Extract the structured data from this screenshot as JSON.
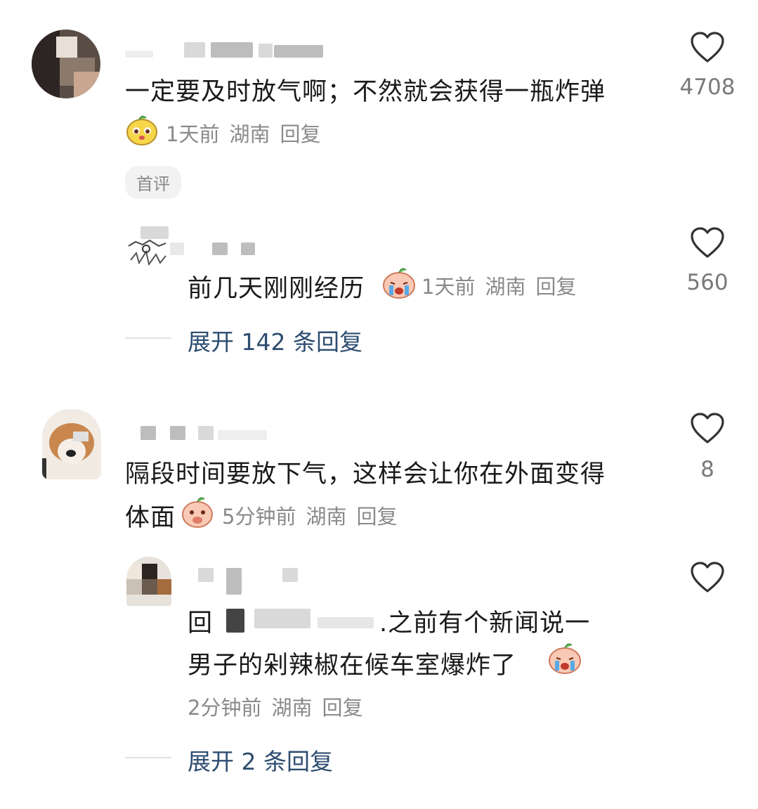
{
  "comments": [
    {
      "text": "一定要及时放气啊；不然就会获得一瓶炸弹",
      "time": "1天前",
      "location": "湖南",
      "reply_label": "回复",
      "likes": "4708",
      "tag": "首评",
      "reply": {
        "text": "前几天刚刚经历",
        "time": "1天前",
        "location": "湖南",
        "reply_label": "回复",
        "likes": "560"
      },
      "expand_label": "展开 142 条回复"
    },
    {
      "text_line1": "隔段时间要放下气，这样会让你在外面变得",
      "text_line2": "体面",
      "time": "5分钟前",
      "location": "湖南",
      "reply_label": "回复",
      "likes": "8",
      "reply": {
        "prefix": "回",
        "text_line1": ".之前有个新闻说一",
        "text_line2": "男子的剁辣椒在候车室爆炸了",
        "time": "2分钟前",
        "location": "湖南",
        "reply_label": "回复"
      },
      "expand_label": "展开 2 条回复"
    }
  ],
  "colors": {
    "expand_link": "#2e4d70",
    "meta_text": "#8a8a8a",
    "main_text": "#1a1a1a"
  },
  "icons": [
    "heart-icon",
    "emoji-icon",
    "avatar"
  ]
}
